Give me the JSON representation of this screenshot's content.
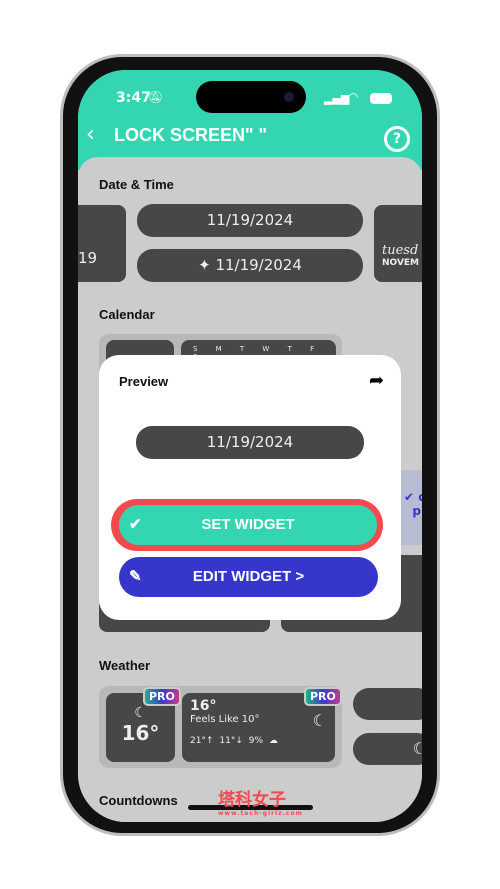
{
  "status": {
    "time": "3:47"
  },
  "header": {
    "title": "LOCK SCREEN\" \"",
    "back": "‹",
    "help": "?"
  },
  "sections": {
    "date_time": "Date & Time",
    "calendar": "Calendar",
    "weather": "Weather",
    "countdowns": "Countdowns"
  },
  "date_widgets": {
    "left_partial": "19",
    "pill1": "11/19/2024",
    "pill2": "11/19/2024",
    "right_day": "tuesd",
    "right_month": "NOVEM"
  },
  "calendar": {
    "weekdays": "S M T W T F S"
  },
  "modal": {
    "title": "Preview",
    "preview_value": "11/19/2024",
    "set_label": "SET WIDGET",
    "edit_label": "EDIT WIDGET >"
  },
  "weather": {
    "small_temp": "16°",
    "big_temp": "16°",
    "feels": "Feels Like 10°",
    "high": "21°↑",
    "low": "11°↓",
    "precip": "9%",
    "pro": "PRO"
  },
  "watermark": {
    "text": "塔科女子",
    "url": "www.tech-girlz.com"
  },
  "colors": {
    "accent": "#33d6b0",
    "edit": "#3636cc",
    "highlight": "#f24a4f"
  }
}
